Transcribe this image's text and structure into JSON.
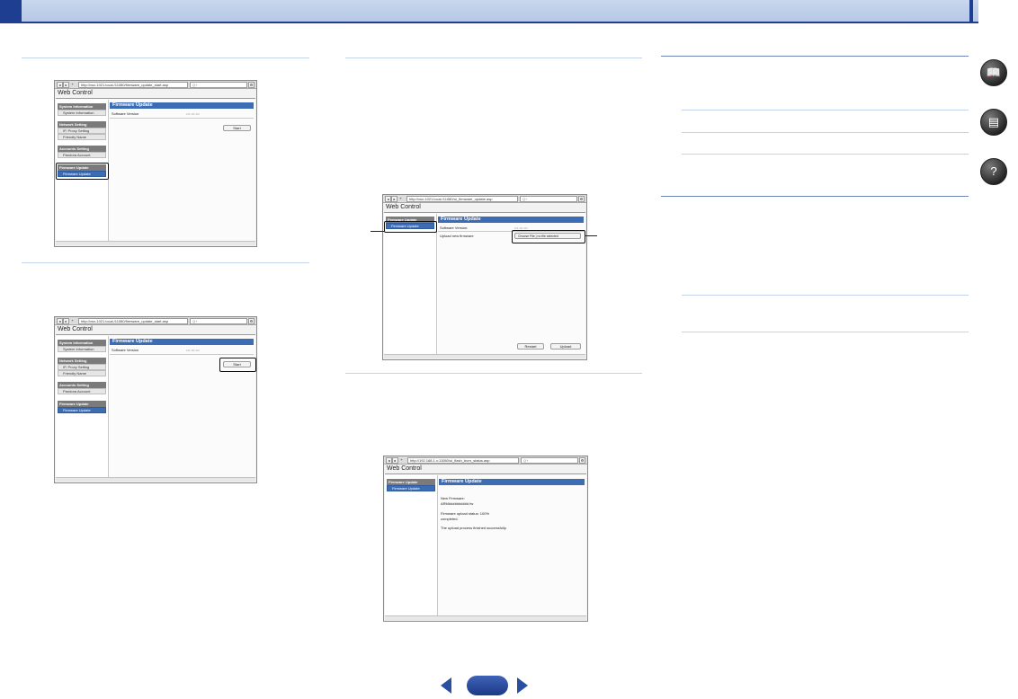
{
  "browser": {
    "url_start": "http://vsx-1021.local./11080/firmware_update_start.asp",
    "url_update": "http://vsx-1021.local./11080/ui_firmware_update.asp",
    "url_status": "http://192.168.1.x:11080/ui_flash_burn_status.asp",
    "search_placeholder": "Q+",
    "nav_back": "◂",
    "nav_forward": "▸",
    "nav_add": "+",
    "url_icon": "e",
    "reload": "C",
    "settings": "⚙"
  },
  "web_control": {
    "title": "Web Control",
    "system_information_head": "System Information",
    "system_information_item": "System Information",
    "network_setting_head": "Network Setting",
    "ip_proxy_item": "IP, Proxy Setting",
    "friendly_name_item": "Friendly Name",
    "accounts_setting_head": "Accounts Setting",
    "pandora_item": "Pandora Account",
    "firmware_update_head": "Firmware Update",
    "firmware_update_item": "Firmware Update",
    "main_title": "Firmware Update",
    "software_version_label": "Software Version",
    "software_version_value": "•••.•••.•••",
    "start_button": "Start",
    "software_version_label2": "Software Version:",
    "upload_label": "Upload new firmware",
    "choose_file": "Choose File",
    "no_file": "no file selected",
    "restart_button": "Restart",
    "upload_button": "Upload",
    "new_firmware_label": "New Firmware:",
    "new_firmware_value": "ARM##########.fw",
    "upload_status": "Firmware upload status: 100%",
    "completed": "completed.",
    "success_message": "The upload process finished successfully."
  },
  "icons": {
    "manual": "book-icon",
    "remote": "remote-icon",
    "help": "help-icon"
  }
}
